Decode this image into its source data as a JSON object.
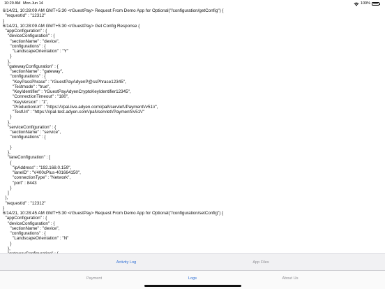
{
  "status_bar": {
    "time": "10:29 AM",
    "date": "Mon Jun 14",
    "battery": "100%",
    "wifi_icon": "wifi-icon",
    "battery_icon": "battery-icon"
  },
  "log_text": "6/14/21, 10:28:09 AM GMT+5:30 <rGuestPay> Request From Demo App for Optional(\"/configuration/getConfig\") {\n  \"requestId\" : \"12312\"\n}\n6/14/21, 10:28:09 AM GMT+5:30 <rGuestPay> Get Config Response {\n  \"appConfiguration\" : {\n    \"deviceConfiguration\" : {\n      \"sectionName\" : \"device\",\n      \"configurations\" : {\n        \"LandscapeOrientation\" : \"Y\"\n      }\n    },\n    \"gatewayConfiguration\" : {\n      \"sectionName\" : \"gateway\",\n      \"configurations\" : {\n        \"KeyPassPhrase\" : \"rGuestPayAdyenP@ssPhrase12345\",\n        \"Testmode\" : \"true\",\n        \"KeyIdentifier\" : \"rGuestPayAdyenCryptoKeyIdentifier12345\",\n        \"ConnectionTimeout\" : \"180\",\n        \"KeyVersion\" : \"1\",\n        \"ProductionUrl\" : \"https:\\/\\/pal-live.adyen.com\\/pal\\/servlet\\/Payment\\/v51\\/\",\n        \"TestUrl\" : \"https:\\/\\/pal-test.adyen.com\\/pal\\/servlet\\/Payment\\/v51\\/\"\n      }\n    },\n    \"serviceConfiguration\" : {\n      \"sectionName\" : \"service\",\n      \"configurations\" : {\n\n      }\n    },\n    \"laneConfiguration\" : [\n      {\n        \"ipAddress\" : \"192.168.0.159\",\n        \"laneID\" : \"V400cPlus-401664150\",\n        \"connectionType\" : \"Network\",\n        \"port\" : 8443\n      }\n    ]\n  },\n  \"requestId\" : \"12312\"\n}\n6/14/21, 10:28:45 AM GMT+5:30 <rGuestPay> Request From Demo App for Optional(\"/configuration/setConfig\") {\n  \"appConfiguration\" : {\n    \"deviceConfiguration\" : {\n      \"sectionName\" : \"device\",\n      \"configurations\" : {\n        \"LandscapeOrientation\" : \"N\"\n      }\n    },\n    \"gatewayConfiguration\" : {",
  "segments": {
    "activity_log": "Activity Log",
    "app_files": "App Files"
  },
  "tabs": {
    "payment": "Payment",
    "logs": "Logs",
    "about_us": "About Us"
  },
  "colors": {
    "accent": "#2f6fd4",
    "inactive": "#8e8e93"
  }
}
